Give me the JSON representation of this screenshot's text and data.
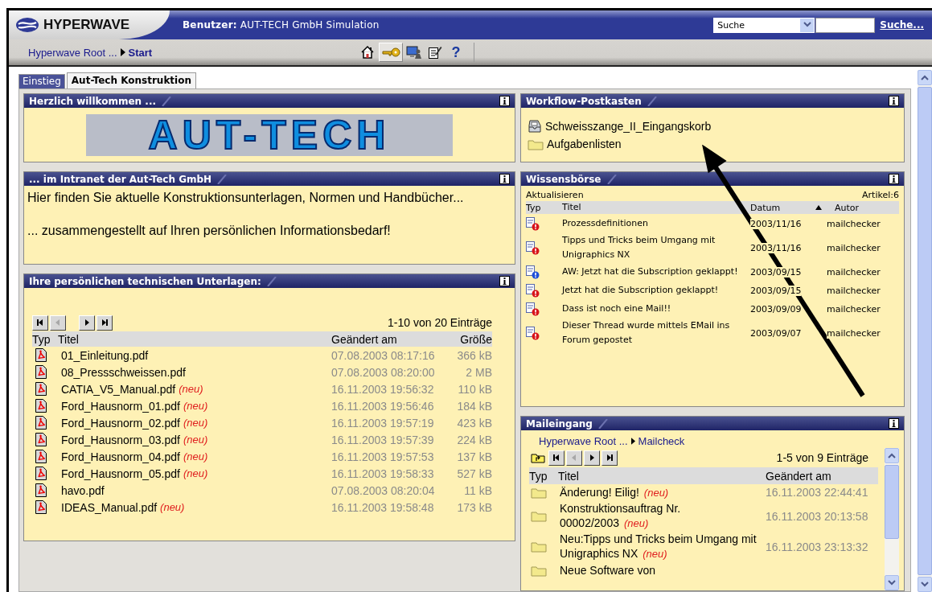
{
  "header": {
    "logo": "HYPERWAVE",
    "user_label": "Benutzer:",
    "user_name": "AUT-TECH GmbH Simulation",
    "search_scope": "Suche",
    "search_link": "Suche..."
  },
  "toolbar": {
    "breadcrumb": [
      {
        "label": "Hyperwave Root ...",
        "current": false
      },
      {
        "label": "Start",
        "current": true
      }
    ],
    "icons": [
      {
        "kind": "home",
        "selected": false
      },
      {
        "kind": "key",
        "selected": true
      },
      {
        "kind": "admin",
        "selected": false
      },
      {
        "kind": "edit",
        "selected": false
      },
      {
        "kind": "help",
        "label": "?",
        "selected": false
      }
    ]
  },
  "tabs": [
    {
      "label": "Einstieg",
      "selected": false
    },
    {
      "label": "Aut-Tech Konstruktion",
      "selected": true
    }
  ],
  "welcome": {
    "title": "Herzlich willkommen ...",
    "logo": "AUT-TECH"
  },
  "intranet": {
    "title": "... im Intranet der Aut-Tech GmbH",
    "paragraphs": [
      "Hier finden Sie aktuelle Konstruktionsunterlagen, Normen und Handbücher...",
      "... zusammengestellt auf Ihren persönlichen Informationsbedarf!"
    ]
  },
  "documents": {
    "title": "Ihre persönlichen technischen Unterlagen:",
    "nav": [
      {
        "kind": "first",
        "disabled": false
      },
      {
        "kind": "prev",
        "disabled": true
      },
      {
        "kind": "next",
        "disabled": false
      },
      {
        "kind": "last",
        "disabled": false
      }
    ],
    "count": "1-10 von 20 Einträge",
    "columns": [
      "Typ",
      "Titel",
      "Geändert am",
      "Größe"
    ],
    "rows": [
      {
        "title": "01_Einleitung.pdf",
        "changed": "07.08.2003 08:17:16",
        "size": "366 kB"
      },
      {
        "title": "08_Pressschweissen.pdf",
        "changed": "07.08.2003 08:20:00",
        "size": "2 MB"
      },
      {
        "title": "CATIA_V5_Manual.pdf",
        "badge": "(neu)",
        "changed": "16.11.2003 19:56:32",
        "size": "110 kB"
      },
      {
        "title": "Ford_Hausnorm_01.pdf",
        "badge": "(neu)",
        "changed": "16.11.2003 19:56:46",
        "size": "184 kB"
      },
      {
        "title": "Ford_Hausnorm_02.pdf",
        "badge": "(neu)",
        "changed": "16.11.2003 19:57:19",
        "size": "423 kB"
      },
      {
        "title": "Ford_Hausnorm_03.pdf",
        "badge": "(neu)",
        "changed": "16.11.2003 19:57:39",
        "size": "224 kB"
      },
      {
        "title": "Ford_Hausnorm_04.pdf",
        "badge": "(neu)",
        "changed": "16.11.2003 19:57:53",
        "size": "137 kB"
      },
      {
        "title": "Ford_Hausnorm_05.pdf",
        "badge": "(neu)",
        "changed": "16.11.2003 19:58:33",
        "size": "527 kB"
      },
      {
        "title": "havo.pdf",
        "changed": "07.08.2003 08:20:04",
        "size": "11 kB"
      },
      {
        "title": "IDEAS_Manual.pdf",
        "badge": "(neu)",
        "changed": "16.11.2003 19:58:48",
        "size": "173 kB"
      }
    ]
  },
  "workflow": {
    "title": "Workflow-Postkasten",
    "items": [
      {
        "kind": "inbox",
        "label": "Schweisszange_II_Eingangskorb"
      },
      {
        "kind": "folder",
        "label": "Aufgabenlisten"
      }
    ]
  },
  "knowledge": {
    "title": "Wissensbörse",
    "refresh": "Aktualisieren",
    "count": "Artikel:6",
    "columns": [
      {
        "label": "Typ",
        "sorted": false
      },
      {
        "label": "Titel",
        "sorted": false
      },
      {
        "label": "Datum",
        "sorted": true
      },
      {
        "label": "Autor",
        "sorted": false
      }
    ],
    "rows": [
      {
        "kind": "question",
        "title": "Prozessdefinitionen",
        "date": "2003/11/16",
        "author": "mailchecker"
      },
      {
        "kind": "question",
        "title": "Tipps und Tricks beim Umgang mit Unigraphics NX",
        "date": "2003/11/16",
        "author": "mailchecker"
      },
      {
        "kind": "notice",
        "title": "AW: Jetzt hat die Subscription geklappt!",
        "date": "2003/09/15",
        "author": "mailchecker"
      },
      {
        "kind": "question",
        "title": "Jetzt hat die Subscription geklappt!",
        "date": "2003/09/15",
        "author": "mailchecker"
      },
      {
        "kind": "question",
        "title": "Dass ist noch eine Mail!!",
        "date": "2003/09/09",
        "author": "mailchecker"
      },
      {
        "kind": "question",
        "title": "Dieser Thread wurde mittels EMail ins Forum gepostet",
        "date": "2003/09/07",
        "author": "mailchecker"
      }
    ]
  },
  "mail": {
    "title": "Maileingang",
    "breadcrumb": [
      "Hyperwave Root ...",
      "Mailcheck"
    ],
    "nav": [
      {
        "kind": "up",
        "disabled": false
      },
      {
        "kind": "first",
        "disabled": false
      },
      {
        "kind": "prev",
        "disabled": true
      },
      {
        "kind": "next",
        "disabled": false
      },
      {
        "kind": "last",
        "disabled": false
      }
    ],
    "count": "1-5 von 9 Einträge",
    "columns": [
      "Typ",
      "Titel",
      "Geändert am"
    ],
    "rows": [
      {
        "title": "Änderung! Eilig!",
        "badge": "(neu)",
        "changed": "16.11.2003 22:44:41"
      },
      {
        "title": "Konstruktionsauftrag Nr. 00002/2003",
        "badge": "(neu)",
        "changed": "16.11.2003 20:13:58"
      },
      {
        "title": "Neu:Tipps und Tricks beim Umgang mit Unigraphics NX",
        "badge": "(neu)",
        "changed": "16.11.2003 23:13:32"
      },
      {
        "title": "Neue Software von",
        "changed": ""
      }
    ]
  }
}
